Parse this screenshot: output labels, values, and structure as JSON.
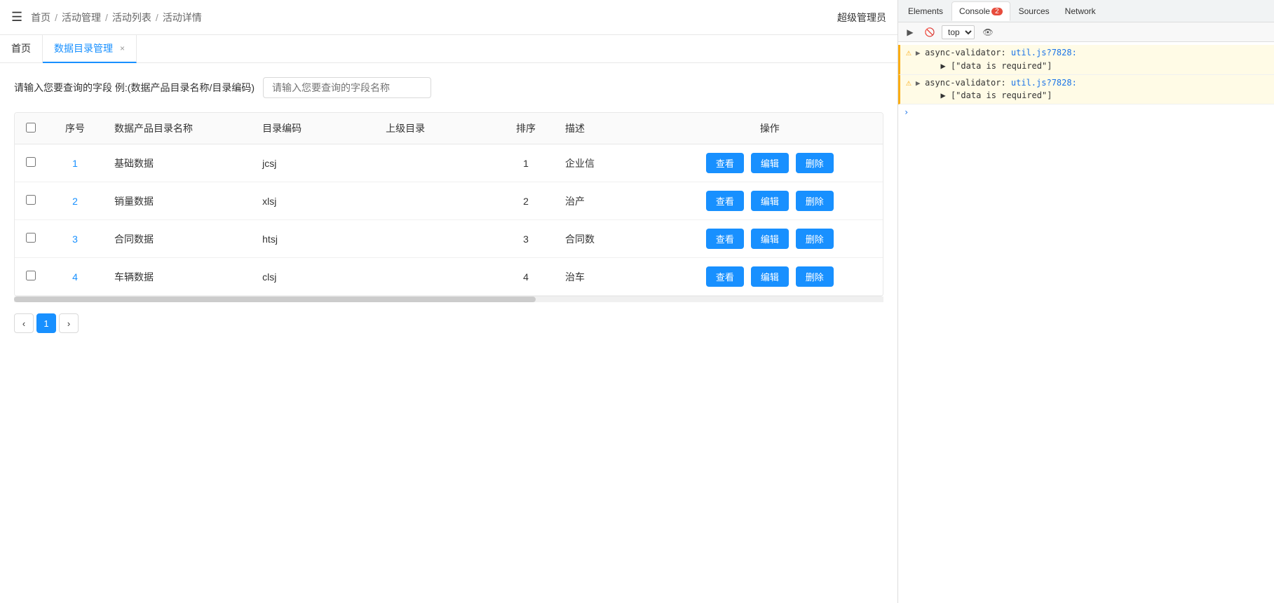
{
  "header": {
    "menu_icon": "☰",
    "breadcrumb": [
      "首页",
      "活动管理",
      "活动列表",
      "活动详情"
    ],
    "user": "超级管理员"
  },
  "tabs": [
    {
      "label": "首页",
      "active": false,
      "closable": false
    },
    {
      "label": "数据目录管理",
      "active": true,
      "closable": true
    }
  ],
  "search": {
    "label": "请输入您要查询的字段  例:(数据产品目录名称/目录编码)",
    "placeholder": "请输入您要查询的字段名称"
  },
  "table": {
    "columns": [
      "",
      "序号",
      "数据产品目录名称",
      "目录编码",
      "上级目录",
      "排序",
      "描述",
      "操作"
    ],
    "rows": [
      {
        "id": 1,
        "num": 1,
        "name": "基础数据",
        "code": "jcsj",
        "parent": "",
        "order": 1,
        "desc": "企业信",
        "actions": [
          "查看",
          "编辑",
          "删除"
        ]
      },
      {
        "id": 2,
        "num": 2,
        "name": "销量数据",
        "code": "xlsj",
        "parent": "",
        "order": 2,
        "desc": "治产",
        "actions": [
          "查看",
          "编辑",
          "删除"
        ]
      },
      {
        "id": 3,
        "num": 3,
        "name": "合同数据",
        "code": "htsj",
        "parent": "",
        "order": 3,
        "desc": "合同数",
        "actions": [
          "查看",
          "编辑",
          "删除"
        ]
      },
      {
        "id": 4,
        "num": 4,
        "name": "车辆数据",
        "code": "clsj",
        "parent": "",
        "order": 4,
        "desc": "治车",
        "actions": [
          "查看",
          "编辑",
          "删除"
        ]
      }
    ]
  },
  "pagination": {
    "prev": "‹",
    "current": 1,
    "next": "›"
  },
  "devtools": {
    "tabs": [
      "Elements",
      "Console",
      "Sources",
      "Network"
    ],
    "active_tab": "Console",
    "badge": "2",
    "toolbar": {
      "filter_placeholder": "top",
      "eye_icon": "👁"
    },
    "console_entries": [
      {
        "type": "warning",
        "icon": "⚠",
        "link_text": "util.js?7828:",
        "prefix": "async-validator: ",
        "suffix": "",
        "arr_text": "[\"data is required\"]"
      },
      {
        "type": "warning",
        "icon": "⚠",
        "link_text": "util.js?7828:",
        "prefix": "async-validator: ",
        "suffix": "",
        "arr_text": "[\"data is required\"]"
      }
    ],
    "bottom_arrow": "›"
  }
}
